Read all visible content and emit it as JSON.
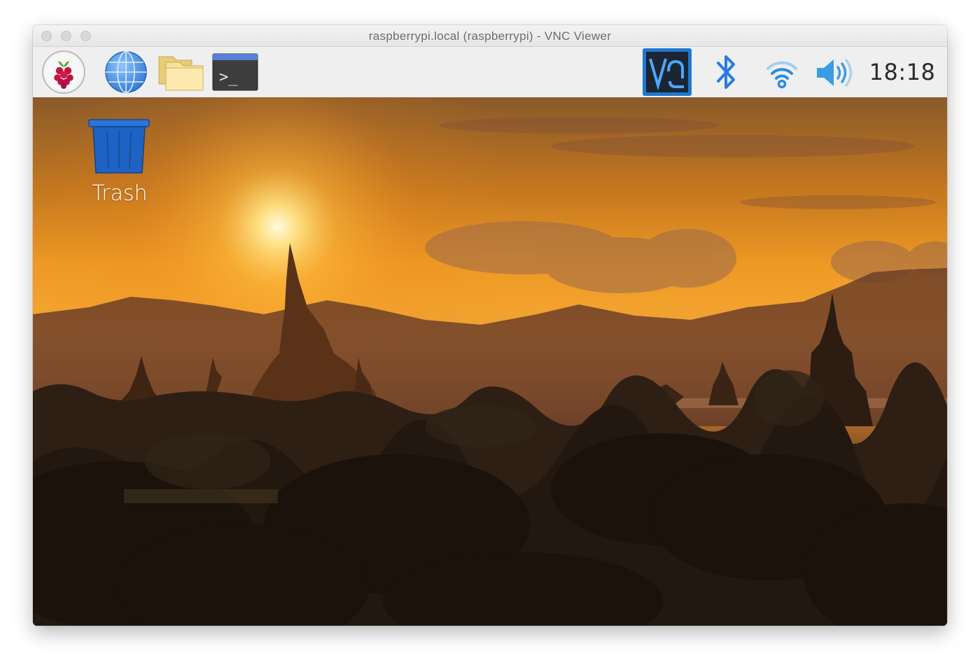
{
  "window": {
    "title": "raspberrypi.local (raspberrypi) - VNC Viewer"
  },
  "taskbar": {
    "launchers": [
      {
        "icon": "raspberry-pi-menu-icon"
      },
      {
        "icon": "web-browser-globe-icon"
      },
      {
        "icon": "file-manager-folder-icon"
      },
      {
        "icon": "terminal-icon",
        "glyph": ">_"
      }
    ],
    "tray": {
      "vnc_label": "V2",
      "clock": "18:18"
    }
  },
  "desktop": {
    "icons": [
      {
        "label": "Trash",
        "icon": "trash-icon"
      }
    ],
    "wallpaper": "sunset-temples-landscape"
  },
  "colors": {
    "vnc_blue": "#1f78d1",
    "bluetooth_blue": "#2a7be4",
    "wifi_blue": "#2a8de0",
    "volume_blue": "#3b9be6",
    "trash_blue": "#1e63c4"
  }
}
